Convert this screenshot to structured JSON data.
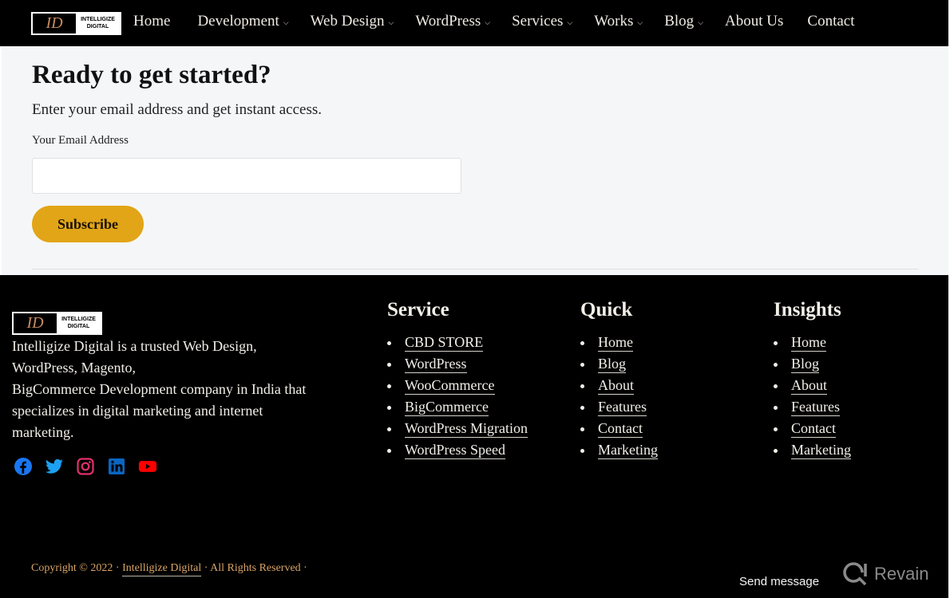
{
  "brand": {
    "mark": "ID",
    "line1": "INTELLIGIZE",
    "line2": "DIGITAL"
  },
  "nav": {
    "items": [
      {
        "label": "Home",
        "has_dropdown": false
      },
      {
        "label": "Development",
        "has_dropdown": true
      },
      {
        "label": "Web Design",
        "has_dropdown": true
      },
      {
        "label": "WordPress",
        "has_dropdown": true
      },
      {
        "label": "Services",
        "has_dropdown": true
      },
      {
        "label": "Works",
        "has_dropdown": true
      },
      {
        "label": "Blog",
        "has_dropdown": true
      },
      {
        "label": "About Us",
        "has_dropdown": false
      },
      {
        "label": "Contact",
        "has_dropdown": false
      }
    ],
    "dropdown_icon": "chevron-down-icon"
  },
  "subscribe": {
    "title": "Ready to get started?",
    "description": "Enter your email address and get instant access.",
    "email_label": "Your Email Address",
    "email_value": "",
    "email_placeholder": "",
    "button_label": "Subscribe",
    "button_color": "#e2a517"
  },
  "footer": {
    "about_lines": [
      "Intelligize Digital is a trusted Web Design,",
      "WordPress, Magento,",
      "BigCommerce Development company in India that",
      "specializes in digital marketing and internet",
      "marketing."
    ],
    "social": [
      {
        "name": "facebook-icon",
        "color": "#1877f2"
      },
      {
        "name": "twitter-icon",
        "color": "#1da1f2"
      },
      {
        "name": "instagram-icon",
        "color": "#e1306c"
      },
      {
        "name": "linkedin-icon",
        "color": "#0a66c2"
      },
      {
        "name": "youtube-icon",
        "color": "#ff0000"
      }
    ],
    "columns": {
      "service": {
        "title": "Service",
        "links": [
          "CBD STORE",
          "WordPress",
          "WooCommerce",
          "BigCommerce",
          "WordPress Migration",
          "WordPress Speed"
        ]
      },
      "quick": {
        "title": "Quick",
        "links": [
          "Home",
          "Blog",
          "About",
          "Features",
          "Contact",
          "Marketing"
        ]
      },
      "insights": {
        "title": "Insights",
        "links": [
          "Home",
          "Blog",
          "About",
          "Features",
          "Contact",
          "Marketing"
        ]
      }
    },
    "copyright": {
      "prefix": "Copyright © 2022 · ",
      "link": "Intelligize Digital",
      "suffix": " · All Rights Reserved ·",
      "color": "#d9a466"
    }
  },
  "widget": {
    "send_message": "Send message",
    "revain_label": "Revain"
  }
}
